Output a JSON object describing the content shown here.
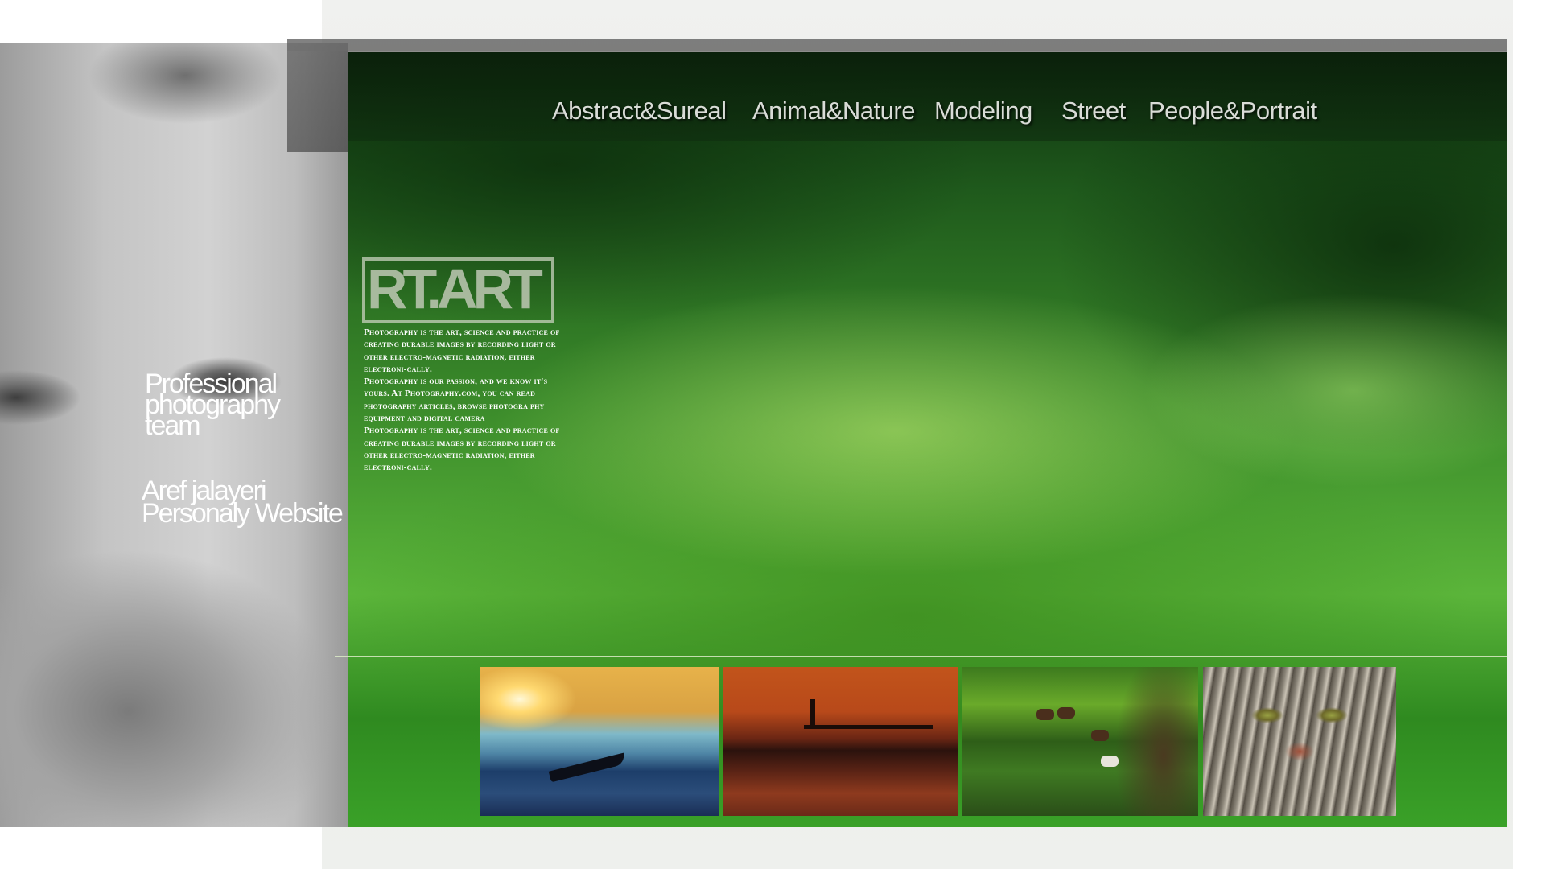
{
  "portrait": {
    "tagline_lines": [
      "Professional",
      "photography",
      "team"
    ],
    "owner_lines": [
      "Aref jalayeri",
      "Personaly Website"
    ]
  },
  "nav": {
    "items": [
      {
        "label": "Abstract&Sureal"
      },
      {
        "label": "Animal&Nature"
      },
      {
        "label": "Modeling"
      },
      {
        "label": "Street"
      },
      {
        "label": "People&Portrait"
      }
    ]
  },
  "logo": {
    "text": "RT.ART"
  },
  "description": {
    "paragraphs": [
      "Photography is the art, science and practice of creating durable images by recording light or other electro-magnetic radiation, either electroni-cally.",
      "Photography is our passion, and we know it's yours. At Photography.com, you can read photography articles, browse photogra phy equipment and digital camera",
      "Photography is the art, science and practice of creating durable images by recording light or other electro-magnetic radiation, either electroni-cally."
    ]
  },
  "thumbnails": [
    {
      "subject": "sunset-boat"
    },
    {
      "subject": "orange-sunset-pier"
    },
    {
      "subject": "horses-forest"
    },
    {
      "subject": "cat-closeup"
    }
  ],
  "colors": {
    "accent_green": "#3aa128",
    "nav_text": "#d9dcd7"
  }
}
